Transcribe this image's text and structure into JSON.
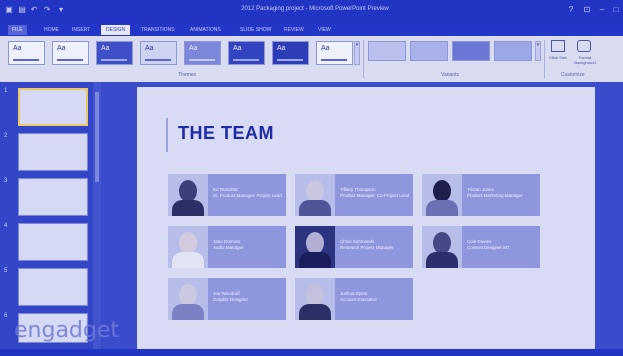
{
  "window": {
    "title": "2012 Packaging project - Microsoft PowerPoint Preview",
    "controls": [
      "?",
      "⊡",
      "–",
      "□"
    ]
  },
  "quick_access": [
    "save-icon",
    "undo-icon",
    "redo-icon",
    "customize-icon"
  ],
  "tabs": [
    {
      "label": "FILE"
    },
    {
      "label": "HOME"
    },
    {
      "label": "INSERT"
    },
    {
      "label": "DESIGN"
    },
    {
      "label": "TRANSITIONS"
    },
    {
      "label": "ANIMATIONS"
    },
    {
      "label": "SLIDE SHOW"
    },
    {
      "label": "REVIEW"
    },
    {
      "label": "VIEW"
    }
  ],
  "active_tab": "DESIGN",
  "ribbon": {
    "themes_label": "Themes",
    "variants_label": "Variants",
    "customize_label": "Customize",
    "theme_sample": "Aa",
    "slide_size_label": "Slide Size",
    "format_background_label": "Format Background"
  },
  "slides": [
    {
      "number": "1"
    },
    {
      "number": "2"
    },
    {
      "number": "3"
    },
    {
      "number": "4"
    },
    {
      "number": "5"
    },
    {
      "number": "6"
    }
  ],
  "slide": {
    "title": "THE TEAM",
    "members": [
      {
        "name": "Ed Ruscetta",
        "role": "Sr. Product Manager, Project Lead"
      },
      {
        "name": "Tiffany Thompson",
        "role": "Product Manager, Co-Project Lead"
      },
      {
        "name": "Tristan Jones",
        "role": "Product Marketing Manager"
      },
      {
        "name": "Jane Dorman",
        "role": "Audio Manager"
      },
      {
        "name": "Chloe Simmonds",
        "role": "Research Project Manager"
      },
      {
        "name": "Cole Davies",
        "role": "Content Designer MT"
      },
      {
        "name": "Joe Woodruff",
        "role": "Graphic Designer"
      },
      {
        "name": "Joshua Spear",
        "role": "Account Executive"
      }
    ]
  },
  "watermark": "engadget",
  "colors": {
    "accent": "#2234c4",
    "slide_title": "#1d2ba8",
    "card": "#8e97dd"
  }
}
